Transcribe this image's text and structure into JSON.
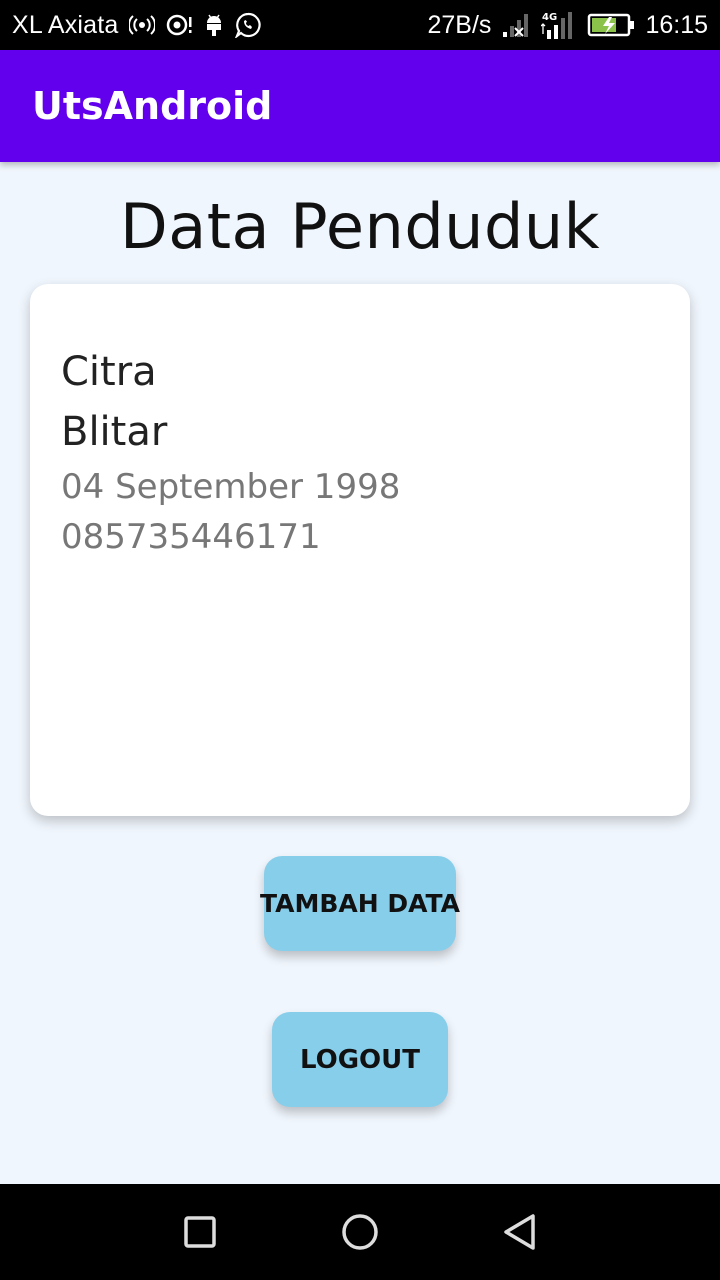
{
  "status_bar": {
    "carrier": "XL Axiata",
    "network_speed": "27B/s",
    "network_type": "4G",
    "time": "16:15",
    "icons": [
      "radio-waves-icon",
      "vpn-eye-icon",
      "android-debug-icon",
      "whatsapp-icon",
      "signal-weak-icon",
      "signal-4g-icon",
      "battery-charging-icon"
    ]
  },
  "app_bar": {
    "title": "UtsAndroid",
    "color": "#6200ee"
  },
  "main": {
    "page_title": "Data Penduduk",
    "card": {
      "name": "Citra",
      "city": "Blitar",
      "birth_date": "04 September 1998",
      "phone": "085735446171"
    },
    "buttons": {
      "add_label": "TAMBAH DATA",
      "logout_label": "LOGOUT",
      "color": "#87ceeb"
    }
  },
  "nav_bar": {
    "items": [
      "recents-icon",
      "home-icon",
      "back-icon"
    ]
  }
}
